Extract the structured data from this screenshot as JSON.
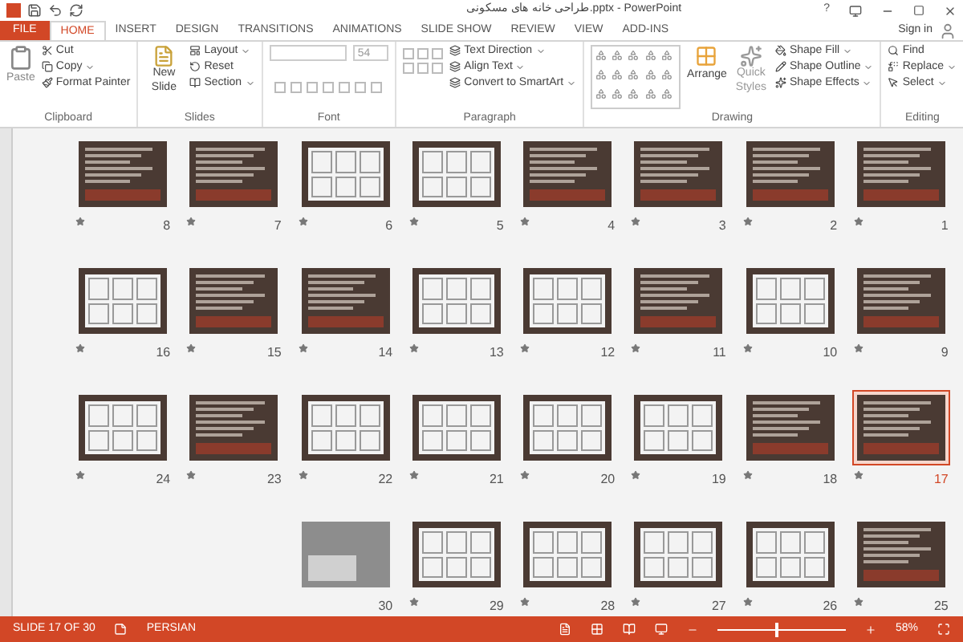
{
  "window": {
    "title": "طراحی خانه های مسکونی.pptx - PowerPoint",
    "sign_in": "Sign in",
    "help": "?"
  },
  "tabs": [
    {
      "label": "FILE",
      "kind": "file",
      "selected": false
    },
    {
      "label": "HOME",
      "kind": "tab",
      "selected": true
    },
    {
      "label": "INSERT",
      "kind": "tab",
      "selected": false
    },
    {
      "label": "DESIGN",
      "kind": "tab",
      "selected": false
    },
    {
      "label": "TRANSITIONS",
      "kind": "tab",
      "selected": false
    },
    {
      "label": "ANIMATIONS",
      "kind": "tab",
      "selected": false
    },
    {
      "label": "SLIDE SHOW",
      "kind": "tab",
      "selected": false
    },
    {
      "label": "REVIEW",
      "kind": "tab",
      "selected": false
    },
    {
      "label": "VIEW",
      "kind": "tab",
      "selected": false
    },
    {
      "label": "ADD-INS",
      "kind": "tab",
      "selected": false
    }
  ],
  "ribbon": {
    "clipboard": {
      "label": "Clipboard",
      "paste": "Paste",
      "cut": "Cut",
      "copy": "Copy",
      "format_painter": "Format Painter"
    },
    "slides": {
      "label": "Slides",
      "new_slide": "New Slide",
      "layout": "Layout",
      "reset": "Reset",
      "section": "Section"
    },
    "font": {
      "label": "Font",
      "size": "54"
    },
    "paragraph": {
      "label": "Paragraph",
      "text_direction": "Text Direction",
      "align_text": "Align Text",
      "convert": "Convert to SmartArt"
    },
    "drawing": {
      "label": "Drawing",
      "arrange": "Arrange",
      "quick_styles": "Quick Styles",
      "shape_fill": "Shape Fill",
      "shape_outline": "Shape Outline",
      "shape_effects": "Shape Effects"
    },
    "editing": {
      "label": "Editing",
      "find": "Find",
      "replace": "Replace",
      "select": "Select"
    }
  },
  "slides": [
    {
      "number": "8",
      "kind": "text",
      "star": true,
      "selected": false
    },
    {
      "number": "7",
      "kind": "text",
      "star": true,
      "selected": false
    },
    {
      "number": "6",
      "kind": "figure",
      "star": true,
      "selected": false
    },
    {
      "number": "5",
      "kind": "figure",
      "star": true,
      "selected": false
    },
    {
      "number": "4",
      "kind": "text",
      "star": true,
      "selected": false
    },
    {
      "number": "3",
      "kind": "text",
      "star": true,
      "selected": false
    },
    {
      "number": "2",
      "kind": "text",
      "star": true,
      "selected": false
    },
    {
      "number": "1",
      "kind": "text",
      "star": true,
      "selected": false
    },
    {
      "number": "16",
      "kind": "figure",
      "star": true,
      "selected": false
    },
    {
      "number": "15",
      "kind": "text",
      "star": true,
      "selected": false
    },
    {
      "number": "14",
      "kind": "text",
      "star": true,
      "selected": false
    },
    {
      "number": "13",
      "kind": "figure",
      "star": true,
      "selected": false
    },
    {
      "number": "12",
      "kind": "figure",
      "star": true,
      "selected": false
    },
    {
      "number": "11",
      "kind": "text",
      "star": true,
      "selected": false
    },
    {
      "number": "10",
      "kind": "figure",
      "star": true,
      "selected": false
    },
    {
      "number": "9",
      "kind": "text",
      "star": true,
      "selected": false
    },
    {
      "number": "24",
      "kind": "figure",
      "star": true,
      "selected": false
    },
    {
      "number": "23",
      "kind": "text",
      "star": true,
      "selected": false
    },
    {
      "number": "22",
      "kind": "figure",
      "star": true,
      "selected": false
    },
    {
      "number": "21",
      "kind": "figure",
      "star": true,
      "selected": false
    },
    {
      "number": "20",
      "kind": "figure",
      "star": true,
      "selected": false
    },
    {
      "number": "19",
      "kind": "figure",
      "star": true,
      "selected": false
    },
    {
      "number": "18",
      "kind": "text",
      "star": true,
      "selected": false
    },
    {
      "number": "17",
      "kind": "text",
      "star": true,
      "selected": true
    },
    {
      "number": "30",
      "kind": "photo",
      "star": false,
      "selected": false
    },
    {
      "number": "29",
      "kind": "figure",
      "star": true,
      "selected": false
    },
    {
      "number": "28",
      "kind": "figure",
      "star": true,
      "selected": false
    },
    {
      "number": "27",
      "kind": "figure",
      "star": true,
      "selected": false
    },
    {
      "number": "26",
      "kind": "figure",
      "star": true,
      "selected": false
    },
    {
      "number": "25",
      "kind": "text",
      "star": true,
      "selected": false
    }
  ],
  "status_bar": {
    "slide": "SLIDE 17 OF 30",
    "language": "PERSIAN",
    "zoom": "58%",
    "level": 0.45
  }
}
